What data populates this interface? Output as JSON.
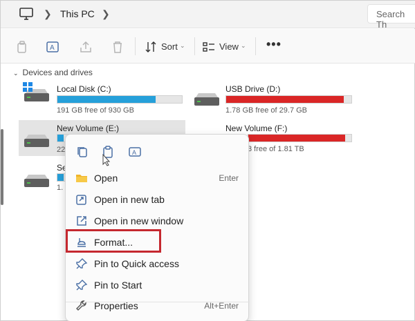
{
  "address": {
    "crumb": "This PC",
    "search_placeholder": "Search Th"
  },
  "toolbar": {
    "sort_label": "Sort",
    "view_label": "View",
    "more_label": "•••"
  },
  "section": {
    "title": "Devices and drives"
  },
  "drives": [
    {
      "name": "Local Disk (C:)",
      "free": "191 GB free of 930 GB",
      "used_fraction": 0.79,
      "bar_color": "#26a0da"
    },
    {
      "name": "USB Drive (D:)",
      "free": "1.78 GB free of 29.7 GB",
      "used_fraction": 0.94,
      "bar_color": "#da2626"
    },
    {
      "name": "New Volume (E:)",
      "free": "22",
      "used_fraction": 0.5,
      "bar_color": "#26a0da"
    },
    {
      "name": "New Volume (F:)",
      "free": "3 free of 1.81 TB",
      "used_fraction": 0.94,
      "bar_color": "#da2626"
    },
    {
      "name": "Se",
      "free": "1.",
      "used_fraction": 0.5,
      "bar_color": "#26a0da"
    }
  ],
  "context_menu": {
    "items": [
      {
        "label": "Open",
        "shortcut": "Enter"
      },
      {
        "label": "Open in new tab",
        "shortcut": ""
      },
      {
        "label": "Open in new window",
        "shortcut": ""
      },
      {
        "label": "Format...",
        "shortcut": ""
      },
      {
        "label": "Pin to Quick access",
        "shortcut": ""
      },
      {
        "label": "Pin to Start",
        "shortcut": ""
      },
      {
        "label": "Properties",
        "shortcut": "Alt+Enter"
      }
    ]
  },
  "colors": {
    "accent": "#26a0da",
    "warning": "#da2626",
    "highlight": "#c5282f"
  }
}
